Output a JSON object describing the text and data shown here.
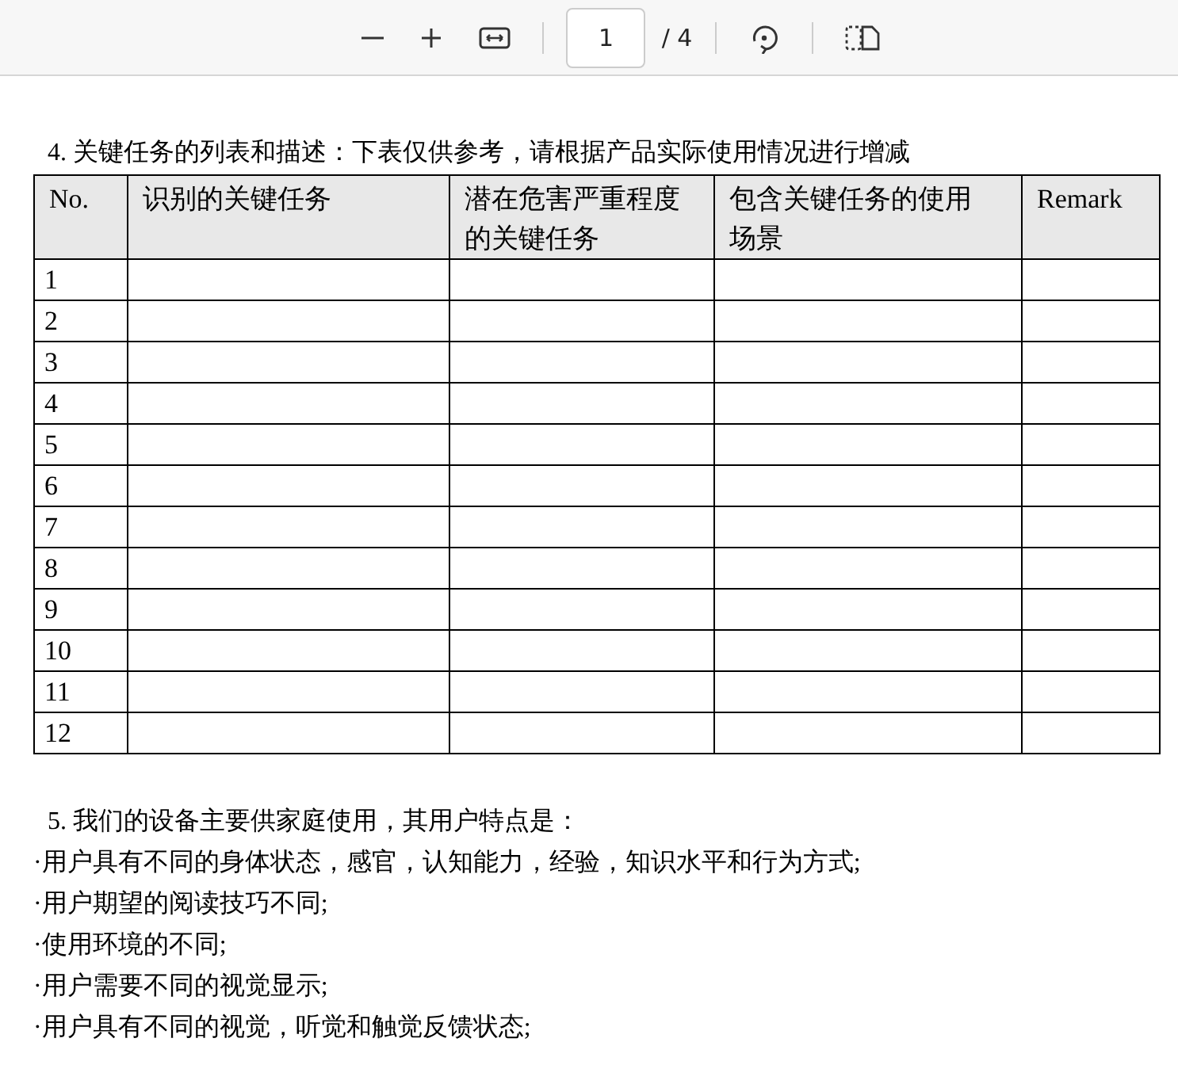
{
  "toolbar": {
    "page_number": "1",
    "page_total": "/ 4"
  },
  "section_4": {
    "heading": "4. 关键任务的列表和描述：下表仅供参考，请根据产品实际使用情况进行增减",
    "table": {
      "columns": [
        "No.",
        "识别的关键任务",
        "潜在危害严重程度的关键任务",
        "包含关键任务的使用场景",
        "Remark"
      ],
      "rows": [
        "1",
        "2",
        "3",
        "4",
        "5",
        "6",
        "7",
        "8",
        "9",
        "10",
        "11",
        "12"
      ]
    }
  },
  "section_5": {
    "heading": "5. 我们的设备主要供家庭使用，其用户特点是：",
    "items": [
      "·用户具有不同的身体状态，感官，认知能力，经验，知识水平和行为方式;",
      "·用户期望的阅读技巧不同;",
      "·使用环境的不同;",
      "·用户需要不同的视觉显示;",
      "·用户具有不同的视觉，听觉和触觉反馈状态;"
    ]
  }
}
